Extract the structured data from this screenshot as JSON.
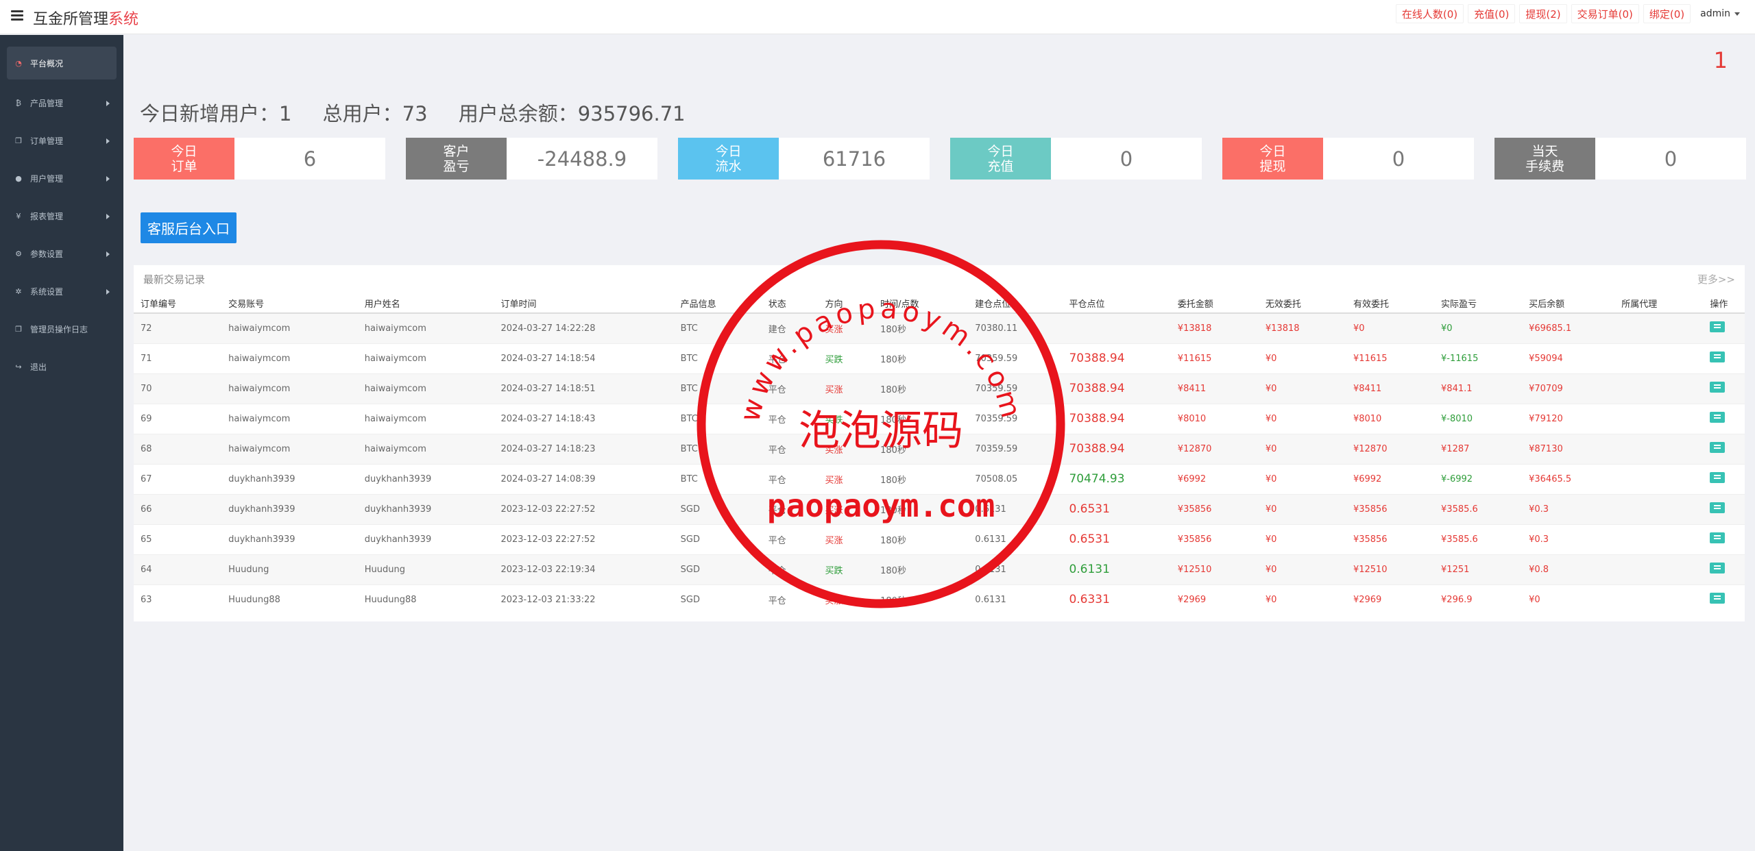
{
  "app": {
    "brand_main": "互金所管理",
    "brand_accent": "系统"
  },
  "topnav": [
    {
      "label": "在线人数(0)"
    },
    {
      "label": "充值(0)"
    },
    {
      "label": "提现(2)"
    },
    {
      "label": "交易订单(0)"
    },
    {
      "label": "绑定(0)"
    }
  ],
  "user": {
    "name": "admin"
  },
  "sidebar": [
    {
      "label": "平台概况",
      "icon": "dashboard-icon",
      "glyph": "◔",
      "active": true
    },
    {
      "label": "产品管理",
      "icon": "bitcoin-icon",
      "glyph": "₿"
    },
    {
      "label": "订单管理",
      "icon": "orders-icon",
      "glyph": "❐"
    },
    {
      "label": "用户管理",
      "icon": "user-icon",
      "glyph": "●"
    },
    {
      "label": "报表管理",
      "icon": "yen-icon",
      "glyph": "¥"
    },
    {
      "label": "参数设置",
      "icon": "settings-icon",
      "glyph": "⚙"
    },
    {
      "label": "系统设置",
      "icon": "cogs-icon",
      "glyph": "✲"
    },
    {
      "label": "管理员操作日志",
      "icon": "log-icon",
      "glyph": "❐"
    },
    {
      "label": "退出",
      "icon": "logout-icon",
      "glyph": "↪"
    }
  ],
  "corner_number": "1",
  "summary": {
    "today_new_users": "今日新增用户：1",
    "total_users": "总用户：73",
    "total_balance": "用户总余额：935796.71"
  },
  "stats": [
    {
      "label_line1": "今日",
      "label_line2": "订单",
      "value": "6",
      "color": "#fb6f67"
    },
    {
      "label_line1": "客户",
      "label_line2": "盈亏",
      "value": "-24488.9",
      "color": "#7b7b7b"
    },
    {
      "label_line1": "今日",
      "label_line2": "流水",
      "value": "61716",
      "color": "#5bc3ef"
    },
    {
      "label_line1": "今日",
      "label_line2": "充值",
      "value": "0",
      "color": "#6ccac4"
    },
    {
      "label_line1": "今日",
      "label_line2": "提现",
      "value": "0",
      "color": "#fb6f67"
    },
    {
      "label_line1": "当天",
      "label_line2": "手续费",
      "value": "0",
      "color": "#7b7b7b"
    }
  ],
  "cs_button": {
    "label": "客服后台入口"
  },
  "panel": {
    "title": "最新交易记录",
    "more": "更多>>"
  },
  "table": {
    "columns": [
      "订单编号",
      "交易账号",
      "用户姓名",
      "订单时间",
      "产品信息",
      "状态",
      "方向",
      "时间/点数",
      "建仓点位",
      "平仓点位",
      "委托金额",
      "无效委托",
      "有效委托",
      "实际盈亏",
      "买后余额",
      "所属代理",
      "操作"
    ],
    "rows": [
      [
        "72",
        "haiwaiymcom",
        "haiwaiymcom",
        "2024-03-27 14:22:28",
        "BTC",
        "建仓",
        "买涨",
        "180秒",
        "70380.11",
        "",
        "¥13818",
        "¥13818",
        "¥0",
        "¥0",
        "¥69685.1",
        ""
      ],
      [
        "71",
        "haiwaiymcom",
        "haiwaiymcom",
        "2024-03-27 14:18:54",
        "BTC",
        "平仓",
        "买跌",
        "180秒",
        "70359.59",
        "70388.94",
        "¥11615",
        "¥0",
        "¥11615",
        "¥-11615",
        "¥59094",
        ""
      ],
      [
        "70",
        "haiwaiymcom",
        "haiwaiymcom",
        "2024-03-27 14:18:51",
        "BTC",
        "平仓",
        "买涨",
        "180秒",
        "70359.59",
        "70388.94",
        "¥8411",
        "¥0",
        "¥8411",
        "¥841.1",
        "¥70709",
        ""
      ],
      [
        "69",
        "haiwaiymcom",
        "haiwaiymcom",
        "2024-03-27 14:18:43",
        "BTC",
        "平仓",
        "买跌",
        "180秒",
        "70359.59",
        "70388.94",
        "¥8010",
        "¥0",
        "¥8010",
        "¥-8010",
        "¥79120",
        ""
      ],
      [
        "68",
        "haiwaiymcom",
        "haiwaiymcom",
        "2024-03-27 14:18:23",
        "BTC",
        "平仓",
        "买涨",
        "180秒",
        "70359.59",
        "70388.94",
        "¥12870",
        "¥0",
        "¥12870",
        "¥1287",
        "¥87130",
        ""
      ],
      [
        "67",
        "duykhanh3939",
        "duykhanh3939",
        "2024-03-27 14:08:39",
        "BTC",
        "平仓",
        "买涨",
        "180秒",
        "70508.05",
        "70474.93",
        "¥6992",
        "¥0",
        "¥6992",
        "¥-6992",
        "¥36465.5",
        ""
      ],
      [
        "66",
        "duykhanh3939",
        "duykhanh3939",
        "2023-12-03 22:27:52",
        "SGD",
        "平仓",
        "买涨",
        "180秒",
        "0.6131",
        "0.6531",
        "¥35856",
        "¥0",
        "¥35856",
        "¥3585.6",
        "¥0.3",
        ""
      ],
      [
        "65",
        "duykhanh3939",
        "duykhanh3939",
        "2023-12-03 22:27:52",
        "SGD",
        "平仓",
        "买涨",
        "180秒",
        "0.6131",
        "0.6531",
        "¥35856",
        "¥0",
        "¥35856",
        "¥3585.6",
        "¥0.3",
        ""
      ],
      [
        "64",
        "Huudung",
        "Huudung",
        "2023-12-03 22:19:34",
        "SGD",
        "平仓",
        "买跌",
        "180秒",
        "0.6131",
        "0.6131",
        "¥12510",
        "¥0",
        "¥12510",
        "¥1251",
        "¥0.8",
        ""
      ],
      [
        "63",
        "Huudung88",
        "Huudung88",
        "2023-12-03 21:33:22",
        "SGD",
        "平仓",
        "买涨",
        "180秒",
        "0.6131",
        "0.6331",
        "¥2969",
        "¥0",
        "¥2969",
        "¥296.9",
        "¥0",
        ""
      ]
    ],
    "close_color": [
      "",
      "red",
      "red",
      "red",
      "red",
      "green",
      "red",
      "red",
      "green",
      "red"
    ],
    "pnl_color": [
      "green",
      "green",
      "red",
      "green",
      "red",
      "green",
      "red",
      "red",
      "red",
      "red"
    ]
  },
  "watermark": {
    "top_arc": "www.paopaoym.com",
    "center": "泡泡源码",
    "bottom": "paopaoym.com"
  },
  "colors": {
    "accent_red": "#e53935",
    "green": "#2e9d3a",
    "sidebar_bg": "#2a3542",
    "op_button": "#37c2b4"
  }
}
